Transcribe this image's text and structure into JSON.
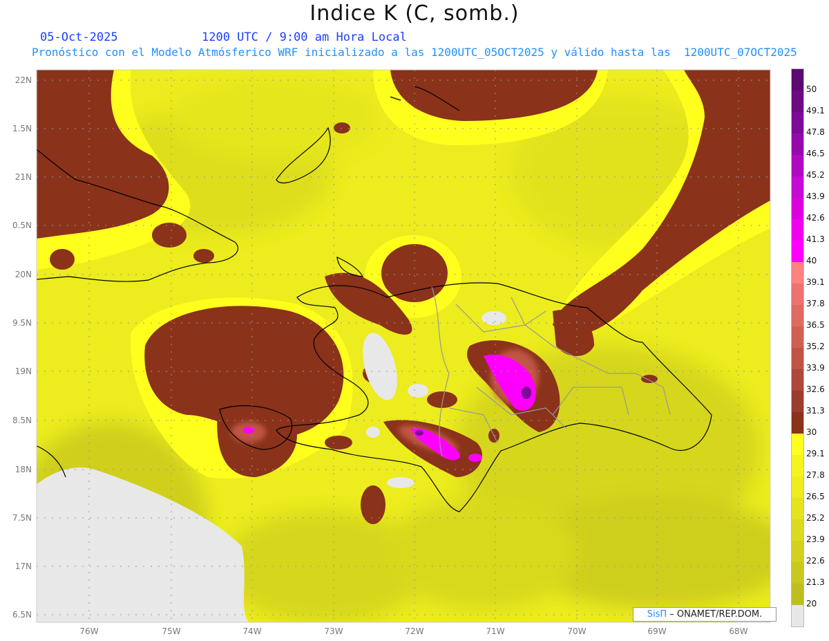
{
  "header": {
    "title": "Indice K (C, somb.)",
    "date": "05-Oct-2025",
    "time": "1200 UTC / 9:00 am Hora Local",
    "subtitle": "Pronóstico con el Modelo Atmósferico WRF inicializado a las 1200UTC_05OCT2025 y válido hasta las  1200UTC_07OCT2025"
  },
  "axes": {
    "lat_labels": [
      "22N",
      "1.5N",
      "21N",
      "0.5N",
      "20N",
      "9.5N",
      "19N",
      "8.5N",
      "18N",
      "7.5N",
      "17N",
      "6.5N"
    ],
    "lon_labels": [
      "76W",
      "75W",
      "74W",
      "73W",
      "72W",
      "71W",
      "70W",
      "69W",
      "68W"
    ]
  },
  "colorbar": {
    "labels": [
      "50",
      "49.1",
      "47.8",
      "46.5",
      "45.2",
      "43.9",
      "42.6",
      "41.3",
      "40",
      "39.1",
      "37.8",
      "36.5",
      "35.2",
      "33.9",
      "32.6",
      "31.3",
      "30",
      "29.1",
      "27.8",
      "26.5",
      "25.2",
      "23.9",
      "22.6",
      "21.3",
      "20"
    ],
    "colors": [
      "#5c0a70",
      "#6c0a82",
      "#7e0a98",
      "#950aad",
      "#ae0ac0",
      "#c60ad2",
      "#dc00e0",
      "#f000f0",
      "#ff00ff",
      "#ff8282",
      "#ef7272",
      "#e06a62",
      "#d06052",
      "#bf5445",
      "#ad483a",
      "#9c3e2e",
      "#8a321a",
      "#ffff1e",
      "#f5f51e",
      "#ecec1e",
      "#e4e41e",
      "#dada1e",
      "#d2d21e",
      "#c8c81e",
      "#bebe1e",
      "#e8e8e8"
    ]
  },
  "credit": {
    "brand": "SisΠ",
    "text": " – ONAMET/REP.DOM."
  }
}
